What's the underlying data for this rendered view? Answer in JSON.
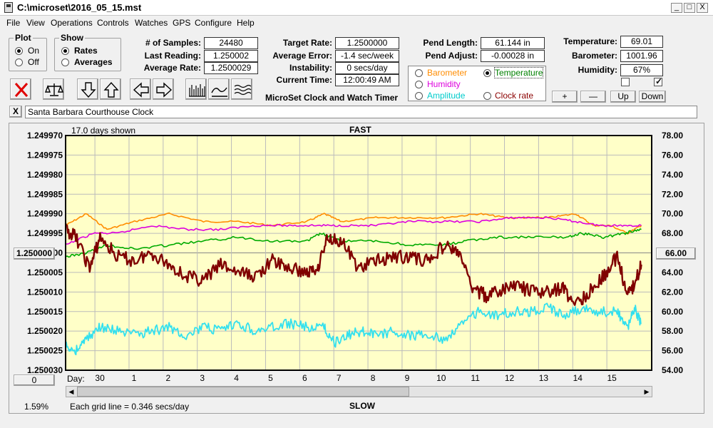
{
  "window": {
    "title": "C:\\microset\\2016_05_15.mst",
    "min_label": "_",
    "max_label": "□",
    "close_label": "X"
  },
  "menu": [
    "File",
    "View",
    "Operations",
    "Controls",
    "Watches",
    "GPS",
    "Configure",
    "Help"
  ],
  "plot_group": {
    "title": "Plot",
    "options": [
      "On",
      "Off"
    ],
    "selected": "On"
  },
  "show_group": {
    "title": "Show",
    "options": [
      "Rates",
      "Averages"
    ],
    "selected": "Rates"
  },
  "stats": {
    "samples_label": "# of Samples:",
    "samples": "24480",
    "last_reading_label": "Last Reading:",
    "last_reading": "1.250002",
    "average_rate_label": "Average Rate:",
    "average_rate": "1.2500029",
    "target_rate_label": "Target Rate:",
    "target_rate": "1.2500000",
    "average_error_label": "Average Error:",
    "average_error": "-1.4 sec/week",
    "instability_label": "Instability:",
    "instability": "0 secs/day",
    "current_time_label": "Current Time:",
    "current_time": "12:00:49 AM",
    "app_name": "MicroSet Clock and Watch Timer",
    "pend_length_label": "Pend Length:",
    "pend_length": "61.144 in",
    "pend_adjust_label": "Pend Adjust:",
    "pend_adjust": "-0.00028 in",
    "temperature_label": "Temperature:",
    "temperature": "69.01",
    "barometer_label": "Barometer:",
    "barometer": "1001.96",
    "humidity_label": "Humidity:",
    "humidity": "67%"
  },
  "sensor_options": [
    {
      "label": "Barometer",
      "color": "#ff8c00",
      "selected": false
    },
    {
      "label": "Temperature",
      "color": "#008000",
      "selected": true
    },
    {
      "label": "Humidity",
      "color": "#dd00dd",
      "selected": false
    },
    {
      "label": "Amplitude",
      "color": "#00cccc",
      "selected": false
    },
    {
      "label": "Clock rate",
      "color": "#8b0000",
      "selected": false
    }
  ],
  "aux_buttons": {
    "plus": "+",
    "minus": "—",
    "up": "Up",
    "down": "Down"
  },
  "checkboxes": [
    {
      "checked": false
    },
    {
      "checked": true
    }
  ],
  "toolbar_icons": [
    "clear-x-icon",
    "balance-scale-icon",
    "arrow-down-icon",
    "arrow-up-icon",
    "arrow-left-icon",
    "arrow-right-icon",
    "bar-chart-icon",
    "wave-icon",
    "multi-wave-icon"
  ],
  "clock_name_close": "X",
  "clock_name": "Santa Barbara Courthouse Clock",
  "graph": {
    "days_shown": "17.0 days shown",
    "top_label": "FAST",
    "bottom_label": "SLOW",
    "day_label": "Day:",
    "left_value_box": "1.250000",
    "right_value_box": "66.00",
    "zero_box": "0",
    "percent": "1.59%",
    "grid_note": "Each grid line = 0.346 secs/day",
    "scroll_left": "◀",
    "scroll_right": "▶"
  },
  "chart_data": {
    "type": "line",
    "title": "FAST",
    "xlabel": "Day:",
    "x_ticks": [
      "30",
      "1",
      "2",
      "3",
      "4",
      "5",
      "6",
      "7",
      "8",
      "9",
      "10",
      "11",
      "12",
      "13",
      "14",
      "15"
    ],
    "y_left_ticks": [
      "1.249970",
      "1.249975",
      "1.249980",
      "1.249985",
      "1.249990",
      "1.249995",
      "1.250000",
      "1.250005",
      "1.250010",
      "1.250015",
      "1.250020",
      "1.250025",
      "1.250030"
    ],
    "y_left_range": [
      1.24997,
      1.25003
    ],
    "y_left_inverted": true,
    "y_right_ticks": [
      "78.00",
      "76.00",
      "74.00",
      "72.00",
      "70.00",
      "68.00",
      "66.00",
      "64.00",
      "62.00",
      "60.00",
      "58.00",
      "56.00",
      "54.00"
    ],
    "y_right_range": [
      54,
      78
    ],
    "x_range": [
      29.2,
      16.2
    ],
    "x_range_days": [
      0,
      17
    ],
    "background": "#ffffc8",
    "grid": true,
    "series": [
      {
        "color": "#ff8c00",
        "axis": "left",
        "x": [
          0,
          0.6,
          1.2,
          2,
          3,
          4,
          5,
          6,
          7,
          7.5,
          8,
          9,
          10,
          11,
          12,
          12.8,
          13.5,
          14,
          14.8,
          15.3,
          15.8,
          16.3,
          16.7
        ],
        "y": [
          1.249993,
          1.24999,
          1.249994,
          1.249992,
          1.24999,
          1.249992,
          1.249992,
          1.249993,
          1.249992,
          1.24999,
          1.249992,
          1.249991,
          1.249991,
          1.249991,
          1.24999,
          1.249991,
          1.249991,
          1.249991,
          1.24999,
          1.249993,
          1.249993,
          1.249995,
          1.249993
        ]
      },
      {
        "color": "#dd00dd",
        "axis": "left",
        "x": [
          0,
          0.8,
          1.5,
          2.5,
          3.5,
          4.5,
          5.5,
          6.5,
          7.2,
          8,
          9,
          10,
          11,
          12,
          13,
          14,
          14.8,
          15.5,
          16,
          16.7
        ],
        "y": [
          1.249998,
          1.249995,
          1.249995,
          1.249993,
          1.249994,
          1.249994,
          1.249993,
          1.249993,
          1.249993,
          1.249993,
          1.249993,
          1.249992,
          1.249992,
          1.249992,
          1.249991,
          1.249991,
          1.249992,
          1.249993,
          1.249993,
          1.249993
        ]
      },
      {
        "color": "#00aa00",
        "axis": "left",
        "x": [
          0,
          0.6,
          1.2,
          2,
          3,
          4,
          5,
          6,
          7,
          7.4,
          8,
          9,
          10,
          11,
          11.6,
          12.5,
          13.5,
          14.5,
          15,
          15.6,
          16.2,
          16.7
        ],
        "y": [
          1.250001,
          1.25,
          1.249998,
          1.249999,
          1.249998,
          1.249997,
          1.249996,
          1.249997,
          1.249997,
          1.249995,
          1.249997,
          1.249997,
          1.249998,
          1.249998,
          1.249997,
          1.249996,
          1.249996,
          1.249996,
          1.249995,
          1.249996,
          1.249995,
          1.249994
        ]
      },
      {
        "color": "#800000",
        "axis": "left",
        "x": [
          0,
          0.3,
          0.7,
          1,
          1.5,
          2,
          2.5,
          3,
          3.5,
          4,
          4.5,
          5,
          5.5,
          6,
          6.5,
          7,
          7.3,
          7.6,
          8,
          8.5,
          9,
          9.5,
          10,
          10.5,
          11,
          11.4,
          11.8,
          12.2,
          12.6,
          13,
          13.5,
          14,
          14.4,
          14.8,
          15.2,
          15.6,
          16,
          16.3,
          16.5,
          16.7
        ],
        "y": [
          1.249994,
          1.249996,
          1.250004,
          1.249996,
          1.250001,
          1.250002,
          1.25,
          1.250003,
          1.250006,
          1.250007,
          1.250003,
          1.250005,
          1.250006,
          1.250002,
          1.250004,
          1.250005,
          1.250004,
          1.249996,
          1.249997,
          1.250004,
          1.250002,
          1.250001,
          1.250001,
          1.250002,
          1.249998,
          1.25,
          1.250009,
          1.250011,
          1.25001,
          1.250008,
          1.25001,
          1.25001,
          1.250009,
          1.250013,
          1.25001,
          1.250006,
          1.250001,
          1.250011,
          1.250008,
          1.250003
        ]
      },
      {
        "color": "#33e0ee",
        "axis": "left",
        "x": [
          0,
          0.3,
          0.6,
          1,
          1.5,
          2,
          2.5,
          3,
          3.5,
          4,
          4.5,
          5,
          5.5,
          6,
          6.5,
          7,
          7.5,
          7.8,
          8.2,
          8.6,
          9,
          9.5,
          10,
          10.5,
          11,
          11.5,
          12,
          12.5,
          13,
          13.5,
          14,
          14.5,
          15,
          15.5,
          16,
          16.3,
          16.5,
          16.7
        ],
        "y": [
          1.250024,
          1.250025,
          1.250022,
          1.250019,
          1.25002,
          1.250021,
          1.25002,
          1.250019,
          1.250021,
          1.250019,
          1.25002,
          1.250018,
          1.25002,
          1.250019,
          1.250018,
          1.250019,
          1.250019,
          1.250023,
          1.250021,
          1.25002,
          1.250021,
          1.25002,
          1.250021,
          1.250021,
          1.250022,
          1.250018,
          1.250015,
          1.250016,
          1.250015,
          1.250015,
          1.250014,
          1.250016,
          1.250014,
          1.250015,
          1.250015,
          1.250019,
          1.250014,
          1.250018
        ]
      }
    ]
  }
}
